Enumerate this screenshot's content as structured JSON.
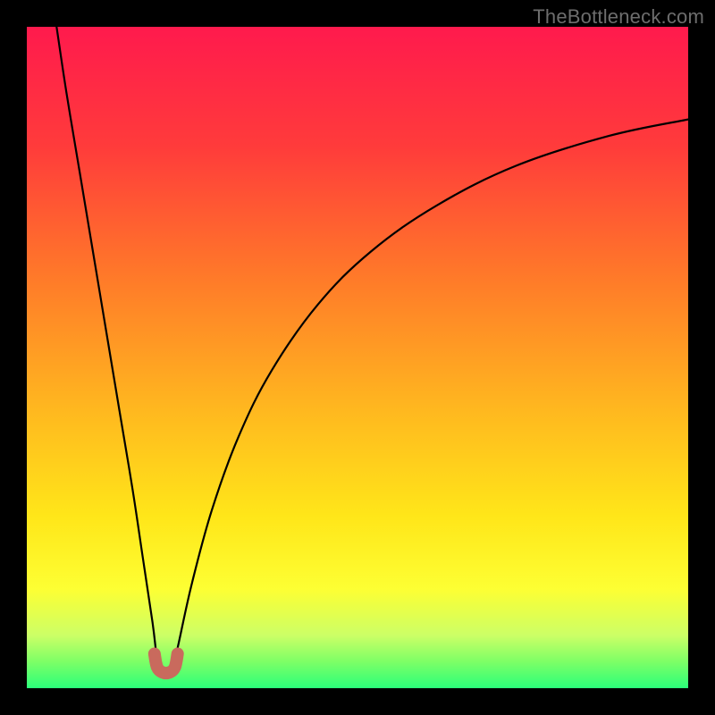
{
  "watermark": "TheBottleneck.com",
  "gradient_stops": [
    {
      "offset": 0.0,
      "color": "#ff1a4d"
    },
    {
      "offset": 0.18,
      "color": "#ff3b3b"
    },
    {
      "offset": 0.38,
      "color": "#ff7a29"
    },
    {
      "offset": 0.58,
      "color": "#ffb81f"
    },
    {
      "offset": 0.74,
      "color": "#ffe619"
    },
    {
      "offset": 0.85,
      "color": "#fdff33"
    },
    {
      "offset": 0.92,
      "color": "#ccff66"
    },
    {
      "offset": 0.96,
      "color": "#7dff66"
    },
    {
      "offset": 1.0,
      "color": "#2bff7a"
    }
  ],
  "chart_data": {
    "type": "line",
    "title": "",
    "xlabel": "",
    "ylabel": "",
    "xlim": [
      0,
      100
    ],
    "ylim": [
      0,
      100
    ],
    "x_min_value": 20,
    "series": [
      {
        "name": "left_branch",
        "points": [
          {
            "x": 4.5,
            "y": 100
          },
          {
            "x": 6.0,
            "y": 90
          },
          {
            "x": 8.0,
            "y": 78
          },
          {
            "x": 10.0,
            "y": 66
          },
          {
            "x": 12.0,
            "y": 54
          },
          {
            "x": 14.0,
            "y": 42
          },
          {
            "x": 16.0,
            "y": 30
          },
          {
            "x": 17.5,
            "y": 20
          },
          {
            "x": 19.0,
            "y": 10
          },
          {
            "x": 19.6,
            "y": 5
          },
          {
            "x": 20.0,
            "y": 2.5
          }
        ]
      },
      {
        "name": "right_branch",
        "points": [
          {
            "x": 22.0,
            "y": 2.5
          },
          {
            "x": 23.0,
            "y": 7
          },
          {
            "x": 25.0,
            "y": 16
          },
          {
            "x": 28.0,
            "y": 27
          },
          {
            "x": 32.0,
            "y": 38
          },
          {
            "x": 37.0,
            "y": 48
          },
          {
            "x": 44.0,
            "y": 58
          },
          {
            "x": 52.0,
            "y": 66
          },
          {
            "x": 62.0,
            "y": 73
          },
          {
            "x": 74.0,
            "y": 79
          },
          {
            "x": 88.0,
            "y": 83.5
          },
          {
            "x": 100.0,
            "y": 86
          }
        ]
      }
    ],
    "bottom_marker": {
      "points": [
        {
          "x": 19.3,
          "y": 5.2
        },
        {
          "x": 19.7,
          "y": 3.2
        },
        {
          "x": 20.5,
          "y": 2.4
        },
        {
          "x": 21.6,
          "y": 2.4
        },
        {
          "x": 22.4,
          "y": 3.2
        },
        {
          "x": 22.8,
          "y": 5.2
        }
      ],
      "color": "#c96a5d",
      "stroke_width_px": 14
    }
  }
}
